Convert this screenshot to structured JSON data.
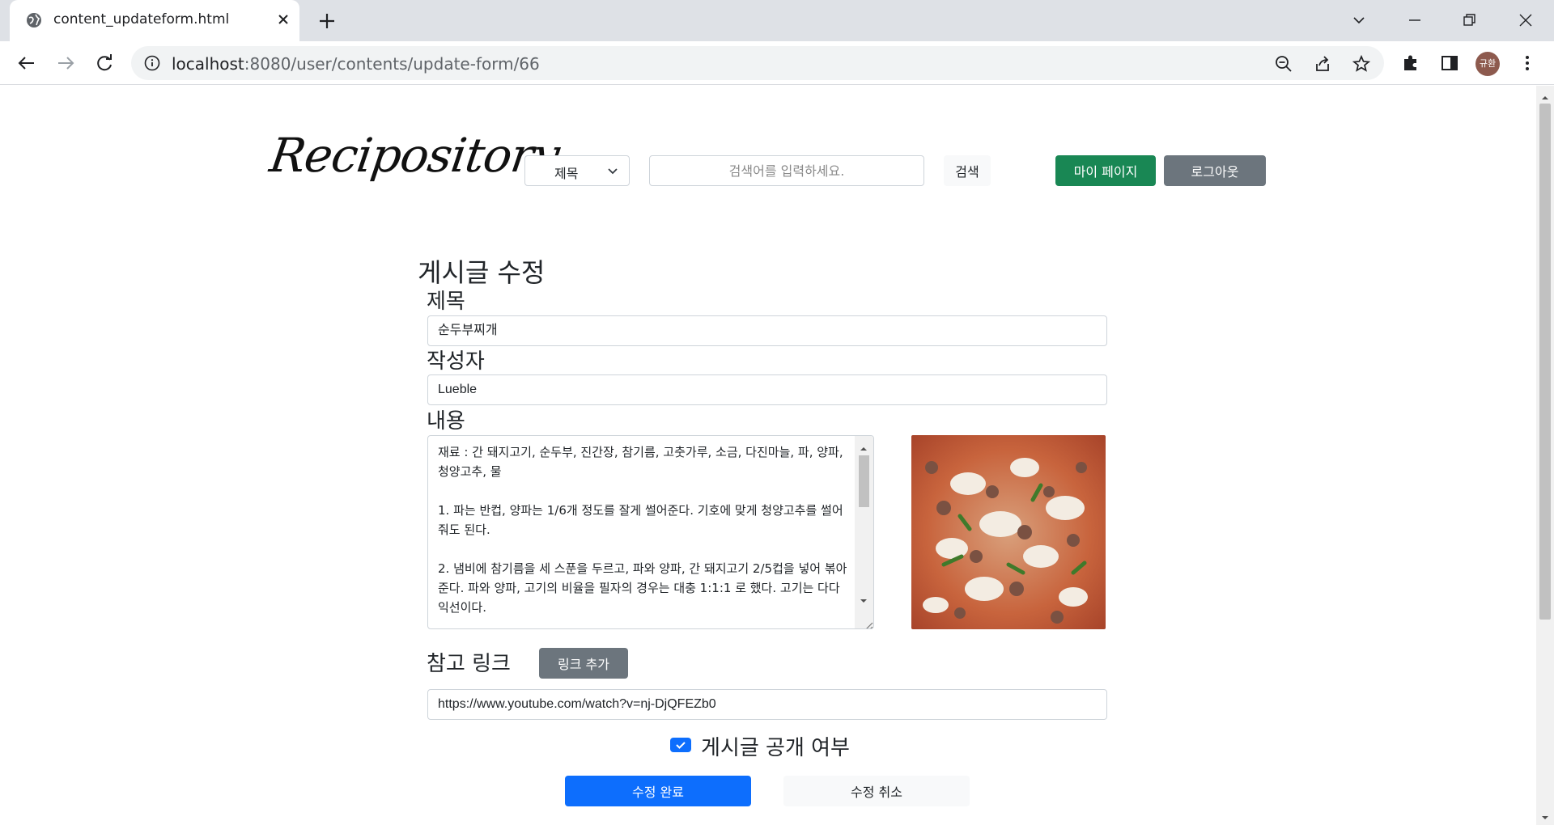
{
  "browser": {
    "tab_title": "content_updateform.html",
    "url_host": "localhost",
    "url_rest": ":8080/user/contents/update-form/66",
    "profile_initials": "규환"
  },
  "header": {
    "logo_text": "Recipository",
    "search_select_value": "제목",
    "search_placeholder": "검색어를 입력하세요.",
    "search_button": "검색",
    "mypage_button": "마이 페이지",
    "logout_button": "로그아웃"
  },
  "form": {
    "page_title": "게시글 수정",
    "title_label": "제목",
    "title_value": "순두부찌개",
    "author_label": "작성자",
    "author_value": "Lueble",
    "content_label": "내용",
    "content_value": "재료 : 간 돼지고기, 순두부, 진간장, 참기름, 고춧가루, 소금, 다진마늘, 파, 양파, 청양고추, 물\n\n1. 파는 반컵, 양파는 1/6개 정도를 잘게 썰어준다. 기호에 맞게 청양고추를 썰어줘도 된다.\n\n2. 냄비에 참기름을 세 스푼을 두르고, 파와 양파, 간 돼지고기 2/5컵을 넣어 볶아준다. 파와 양파, 고기의 비율을 필자의 경우는 대충 1:1:1 로 했다. 고기는 다다익선이다.",
    "link_label": "참고 링크",
    "add_link_button": "링크 추가",
    "link_value": "https://www.youtube.com/watch?v=nj-DjQFEZb0",
    "public_checkbox_label": "게시글 공개 여부",
    "public_checked": true,
    "submit_button": "수정 완료",
    "cancel_button": "수정 취소"
  },
  "colors": {
    "primary": "#0d6efd",
    "success": "#198754",
    "secondary": "#6c757d",
    "light": "#f8f9fa"
  }
}
